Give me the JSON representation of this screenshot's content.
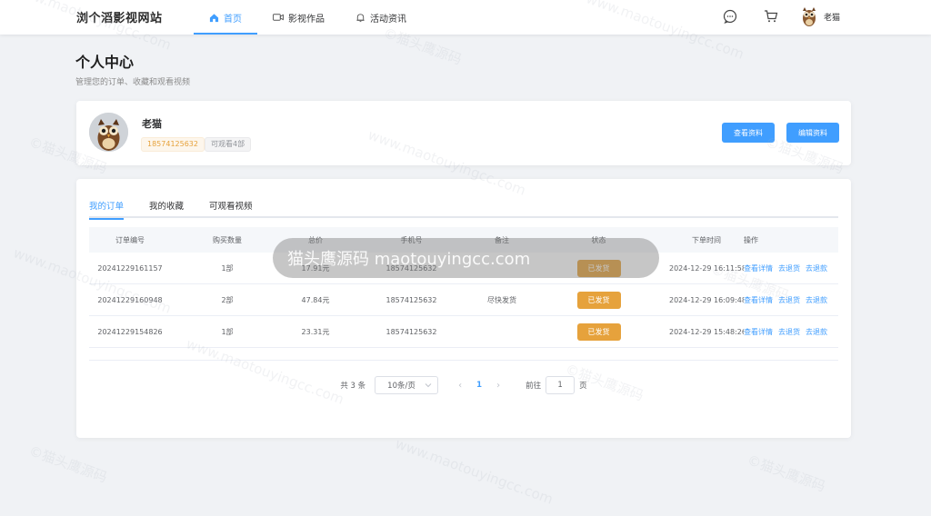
{
  "header": {
    "logo": "浏个滔影视网站",
    "nav": [
      {
        "label": "首页",
        "icon": "home-icon",
        "active": true
      },
      {
        "label": "影视作品",
        "icon": "video-icon",
        "active": false
      },
      {
        "label": "活动资讯",
        "icon": "bell-icon",
        "active": false
      }
    ],
    "user_name": "老猫",
    "accent": "#409eff"
  },
  "page": {
    "title": "个人中心",
    "subtitle": "管理您的订单、收藏和观看视频"
  },
  "profile": {
    "name": "老猫",
    "phone": "18574125632",
    "watchable": "可观看4部",
    "view_button": "查看资料",
    "edit_button": "编辑资料"
  },
  "tabs": [
    "我的订单",
    "我的收藏",
    "可观看视频"
  ],
  "table": {
    "headers": [
      "订单编号",
      "购买数量",
      "总价",
      "手机号",
      "备注",
      "状态",
      "下单时间",
      "操作"
    ],
    "rows": [
      {
        "id": "20241229161157",
        "qty": "1部",
        "price": "17.91元",
        "phone": "18574125632",
        "note": "",
        "status": "已发货",
        "time": "2024-12-29 16:11:58"
      },
      {
        "id": "20241229160948",
        "qty": "2部",
        "price": "47.84元",
        "phone": "18574125632",
        "note": "尽快发货",
        "status": "已发货",
        "time": "2024-12-29 16:09:48"
      },
      {
        "id": "20241229154826",
        "qty": "1部",
        "price": "23.31元",
        "phone": "18574125632",
        "note": "",
        "status": "已发货",
        "time": "2024-12-29 15:48:26"
      }
    ],
    "ops": [
      "查看详情",
      "去退货",
      "去退款"
    ]
  },
  "pager": {
    "total": "共 3 条",
    "page_size": "10条/页",
    "current": "1",
    "goto_label": "前往",
    "goto_value": "1",
    "goto_suffix": "页"
  },
  "watermark": {
    "banner": "猫头鹰源码 maotouyingcc.com",
    "text": "©猫头鹰源码",
    "url": "www.maotouyingcc.com"
  }
}
